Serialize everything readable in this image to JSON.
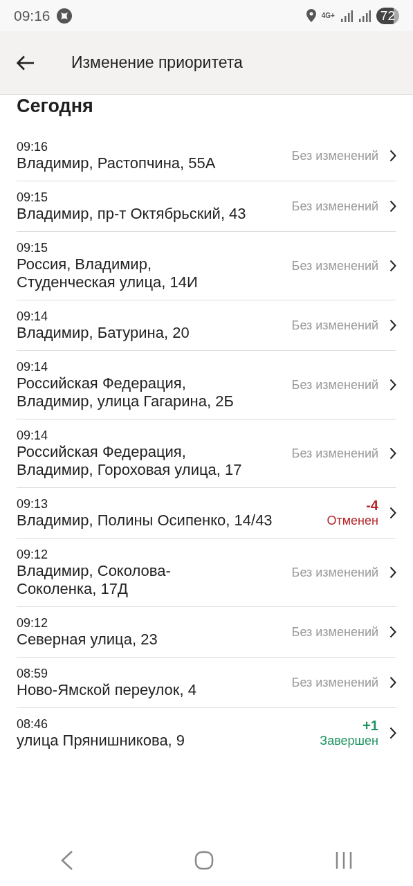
{
  "status_bar": {
    "time": "09:16",
    "network": "4G+",
    "battery": "72"
  },
  "app_bar": {
    "title": "Изменение приоритета"
  },
  "section": "Сегодня",
  "entries": [
    {
      "time": "09:16",
      "address": [
        "Владимир, Растопчина, 55А"
      ],
      "kind": "none",
      "status": "Без изменений"
    },
    {
      "time": "09:15",
      "address": [
        "Владимир, пр-т Октябрьский, 43"
      ],
      "kind": "none",
      "status": "Без изменений"
    },
    {
      "time": "09:15",
      "address": [
        "Россия, Владимир,",
        "Студенческая улица, 14И"
      ],
      "kind": "none",
      "status": "Без изменений"
    },
    {
      "time": "09:14",
      "address": [
        "Владимир, Батурина, 20"
      ],
      "kind": "none",
      "status": "Без изменений"
    },
    {
      "time": "09:14",
      "address": [
        "Российская Федерация,",
        "Владимир, улица Гагарина, 2Б"
      ],
      "kind": "none",
      "status": "Без изменений"
    },
    {
      "time": "09:14",
      "address": [
        "Российская Федерация,",
        "Владимир, Гороховая улица, 17"
      ],
      "kind": "none",
      "status": "Без изменений"
    },
    {
      "time": "09:13",
      "address": [
        "Владимир, Полины Осипенко, 14/43"
      ],
      "kind": "cancelled",
      "delta": "-4",
      "status": "Отменен"
    },
    {
      "time": "09:12",
      "address": [
        "Владимир, Соколова-",
        "Соколенка, 17Д"
      ],
      "kind": "none",
      "status": "Без изменений"
    },
    {
      "time": "09:12",
      "address": [
        "Северная улица, 23"
      ],
      "kind": "none",
      "status": "Без изменений"
    },
    {
      "time": "08:59",
      "address": [
        "Ново-Ямской переулок, 4"
      ],
      "kind": "none",
      "status": "Без изменений"
    },
    {
      "time": "08:46",
      "address": [
        "улица Прянишникова, 9"
      ],
      "kind": "done",
      "delta": "+1",
      "status": "Завершен"
    }
  ]
}
